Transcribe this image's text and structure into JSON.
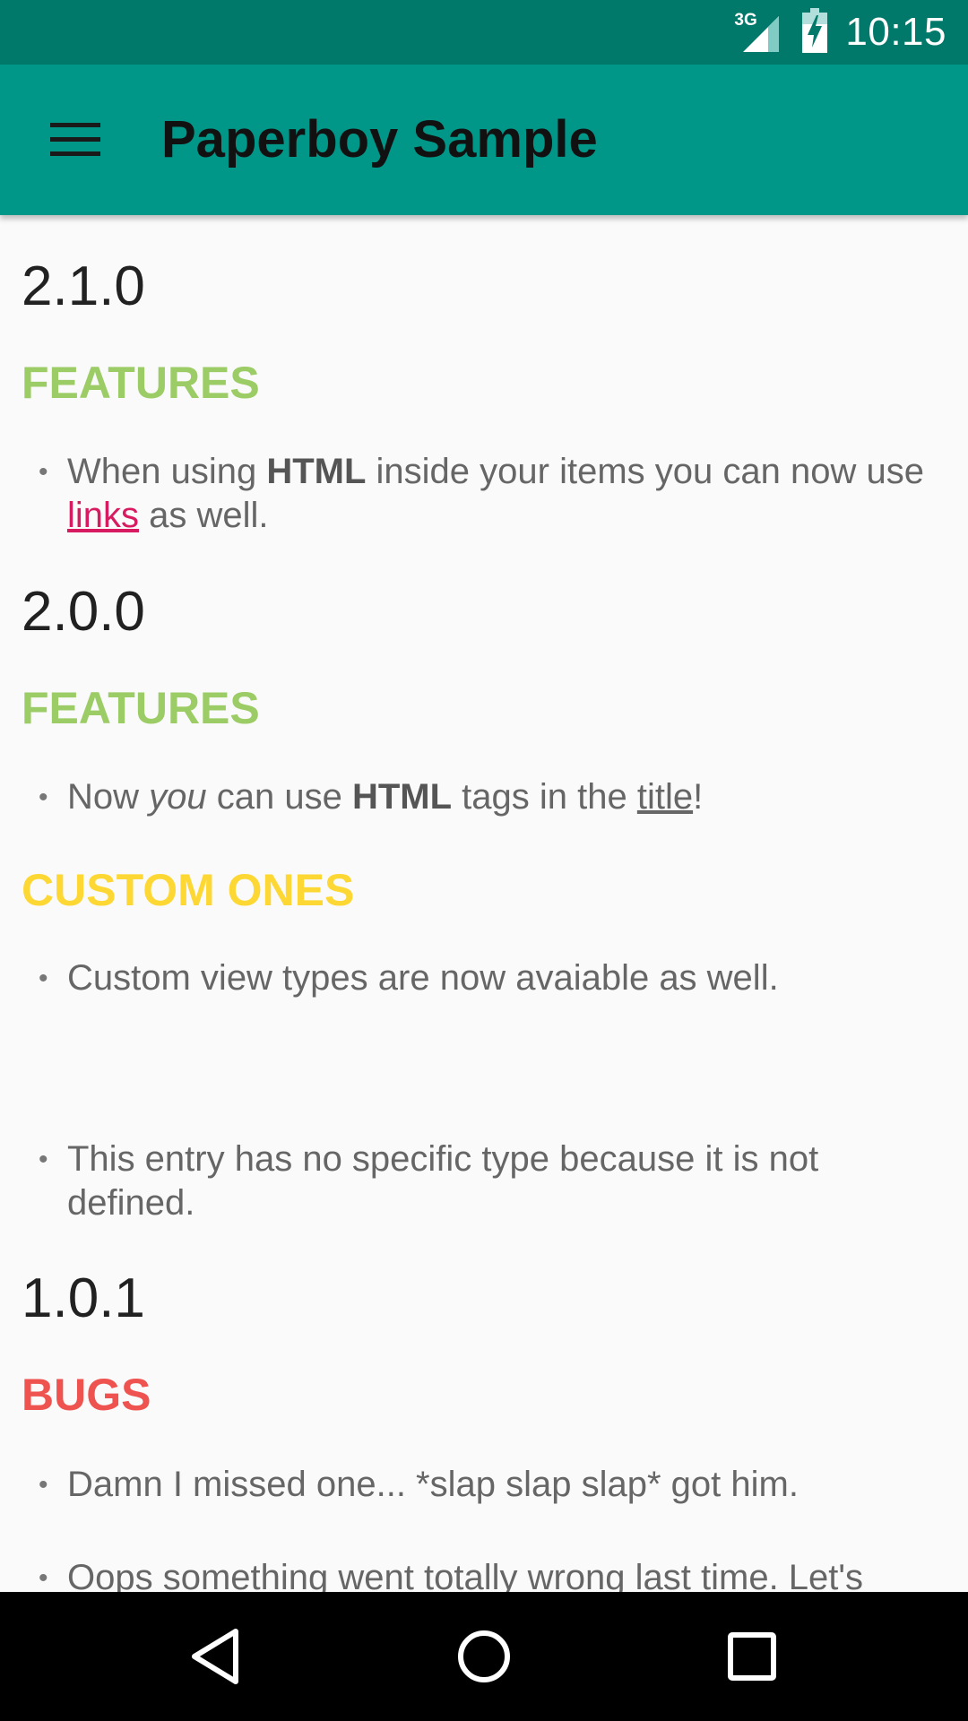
{
  "status_bar": {
    "network": "3G",
    "time": "10:15"
  },
  "app_bar": {
    "title": "Paperboy Sample"
  },
  "colors": {
    "status_bar": "#00796b",
    "app_bar": "#009688",
    "features": "#9ccc65",
    "custom": "#fdd835",
    "bugs": "#ef5350",
    "link": "#d81b60"
  },
  "changelog": [
    {
      "version": "2.1.0",
      "section": "FEATURES",
      "item_parts": [
        "When using ",
        "HTML",
        " inside your items you can now use ",
        "links",
        " as well."
      ]
    },
    {
      "version": "2.0.0",
      "sections": [
        {
          "section": "FEATURES",
          "item_parts": [
            "Now ",
            "you",
            " can use ",
            "HTML",
            " tags in the ",
            "title",
            "!"
          ]
        },
        {
          "section": "CUSTOM ONES",
          "item": "Custom view types are now avaiable as well."
        },
        {
          "item": "This entry has no specific type because it is not defined."
        }
      ]
    },
    {
      "version": "1.0.1",
      "section": "BUGS",
      "items": [
        "Damn I missed one... *slap slap slap* got him.",
        "Oops something went totally wrong last time. Let's"
      ]
    }
  ],
  "nav_bar": {
    "back": "back-icon",
    "home": "home-icon",
    "recents": "recents-icon"
  }
}
